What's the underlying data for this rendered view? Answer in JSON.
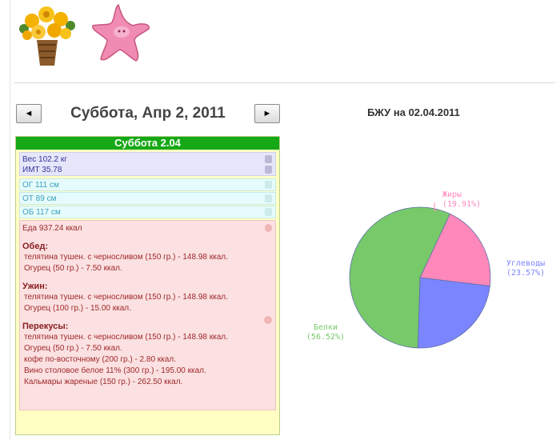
{
  "header": {
    "images": [
      "flower-basket",
      "pink-starfish"
    ]
  },
  "date_nav": {
    "prev_label": "◄",
    "title": "Суббота, Апр 2, 2011",
    "next_label": "►"
  },
  "day": {
    "header": "Суббота 2.04",
    "weight": "Вес 102.2 кг",
    "bmi": "ИМТ 35.78",
    "measurements": [
      "ОГ 111 см",
      "ОТ 89 см",
      "ОБ 117 см"
    ],
    "food_total": "Еда 937.24 ккал",
    "meals": [
      {
        "title": "Обед:",
        "items": [
          "телятина тушен. с черносливом (150 гр.) - 148.98 ккал.",
          "Огурец (50 гр.) - 7.50 ккал."
        ]
      },
      {
        "title": "Ужин:",
        "items": [
          "телятина тушен. с черносливом (150 гр.) - 148.98 ккал.",
          "Огурец (100 гр.) - 15.00 ккал."
        ]
      },
      {
        "title": "Перекусы:",
        "items": [
          "телятина тушен. с черносливом (150 гр.) - 148.98 ккал.",
          "Огурец (50 гр.) - 7.50 ккал.",
          "кофе по-восточному (200 гр.) - 2.80 ккал.",
          "Вино столовое белое 11% (300 гр.) - 195.00 ккал.",
          "Кальмары жареные (150 гр.) - 262.50 ккал."
        ]
      }
    ]
  },
  "chart_data": {
    "type": "pie",
    "title": "БЖУ на 02.04.2011",
    "slices": [
      {
        "name": "Жиры",
        "label": "(19.91%)",
        "value": 19.91,
        "color": "#ff88bb"
      },
      {
        "name": "Углеводы",
        "label": "(23.57%)",
        "value": 23.57,
        "color": "#7b85ff"
      },
      {
        "name": "Белки",
        "label": "(56.52%)",
        "value": 56.52,
        "color": "#77c96a"
      }
    ]
  },
  "colors": {
    "accent_green": "#16a816",
    "panel_bg": "#ffffc4",
    "weight_bg": "#e6e6fb",
    "measure_bg": "#e6fbfb",
    "food_bg": "#fbe1e1"
  }
}
